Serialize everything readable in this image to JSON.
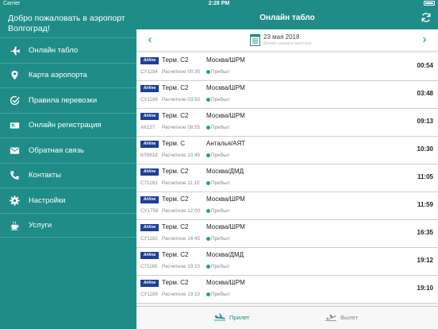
{
  "status_bar": {
    "carrier": "Carrier",
    "time": "2:28 PM"
  },
  "sidebar": {
    "welcome": "Добро пожаловать в аэропорт Волгоград!",
    "items": [
      {
        "label": "Онлайн табло",
        "icon": "plane-icon"
      },
      {
        "label": "Карта аэропорта",
        "icon": "map-pin-icon"
      },
      {
        "label": "Правила перевозки",
        "icon": "check-circle-icon"
      },
      {
        "label": "Онлайн регистрация",
        "icon": "ticket-icon"
      },
      {
        "label": "Обратная связь",
        "icon": "envelope-icon"
      },
      {
        "label": "Контакты",
        "icon": "phone-icon"
      },
      {
        "label": "Настройки",
        "icon": "gear-icon"
      },
      {
        "label": "Услуги",
        "icon": "coffee-icon"
      }
    ]
  },
  "header": {
    "title": "Онлайн табло"
  },
  "date_bar": {
    "date": "23 мая 2018",
    "note": "Время указано местное"
  },
  "flights": [
    {
      "airline": "Airline",
      "terminal": "Терм. C2",
      "destination": "Москва/ШРМ",
      "flight_no": "СУ1184",
      "scheduled": "Расчетное 00:35",
      "status": "Прибыл",
      "time": "00:54"
    },
    {
      "airline": "Airline",
      "terminal": "Терм. C2",
      "destination": "Москва/ШРМ",
      "flight_no": "СУ1188",
      "scheduled": "Расчетное 03:50",
      "status": "Прибыл",
      "time": "03:48"
    },
    {
      "airline": "Airline",
      "terminal": "Терм. C2",
      "destination": "Москва/ШРМ",
      "flight_no": "АК227",
      "scheduled": "Расчетное 08:55",
      "status": "Прибыл",
      "time": "09:13"
    },
    {
      "airline": "Airline",
      "terminal": "Терм. C",
      "destination": "Анталья/АЯТ",
      "flight_no": "КЛ5818",
      "scheduled": "Расчетное 10:45",
      "status": "Прибыл",
      "time": "10:30"
    },
    {
      "airline": "Airline",
      "terminal": "Терм. C2",
      "destination": "Москва/ДМД",
      "flight_no": "С71163",
      "scheduled": "Расчетное 11:10",
      "status": "Прибыл",
      "time": "11:05"
    },
    {
      "airline": "Airline",
      "terminal": "Терм. C2",
      "destination": "Москва/ШРМ",
      "flight_no": "СУ1758",
      "scheduled": "Расчетное 12:00",
      "status": "Прибыл",
      "time": "11:59"
    },
    {
      "airline": "Airline",
      "terminal": "Терм. C2",
      "destination": "Москва/ШРМ",
      "flight_no": "СУ1182",
      "scheduled": "Расчетное 16:45",
      "status": "Прибыл",
      "time": "16:35"
    },
    {
      "airline": "Airline",
      "terminal": "Терм. C2",
      "destination": "Москва/ДМД",
      "flight_no": "С71165",
      "scheduled": "Расчетное 19:10",
      "status": "Прибыл",
      "time": "19:12"
    },
    {
      "airline": "Airline",
      "terminal": "Терм. C2",
      "destination": "Москва/ШРМ",
      "flight_no": "СУ1186",
      "scheduled": "Расчетное 19:10",
      "status": "Прибыл",
      "time": "19:10"
    }
  ],
  "tabs": {
    "arrivals": "Прилет",
    "departures": "Вылет"
  },
  "colors": {
    "accent": "#1f8c87",
    "status_ok": "#22a867",
    "airline_logo": "#1f3f96"
  }
}
